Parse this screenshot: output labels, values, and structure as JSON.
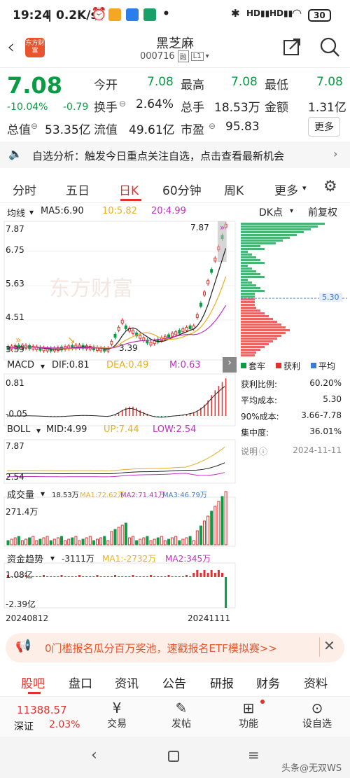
{
  "status": {
    "time": "19:24",
    "speed": "0.2K/s",
    "battery": "30"
  },
  "header": {
    "logo_text": "东方财富",
    "stock_name": "黑芝麻",
    "stock_code": "000716",
    "tag1": "融",
    "tag2": "L1"
  },
  "quote": {
    "price": "7.08",
    "change_pct": "-10.04%",
    "change": "-0.79",
    "open_label": "今开",
    "open": "7.08",
    "high_label": "最高",
    "high": "7.08",
    "low_label": "最低",
    "low": "7.08",
    "turnover_label": "换手",
    "turnover": "2.64%",
    "volume_label": "总手",
    "volume": "18.53万",
    "amount_label": "金额",
    "amount": "1.31亿",
    "mcap_label": "总值",
    "mcap": "53.35亿",
    "float_label": "流值",
    "float": "49.61亿",
    "pe_label": "市盈",
    "pe": "95.83",
    "more_label": "更多"
  },
  "banner": {
    "text": "自选分析：触发今日重点关注自选，点击查看最新机会"
  },
  "tabs": [
    "分时",
    "五日",
    "日K",
    "60分钟",
    "周K",
    "更多"
  ],
  "active_tab": "日K",
  "chart": {
    "ma_label": "均线",
    "ma5": "MA5:6.90",
    "ma10": "10:5.82",
    "ma20": "20:4.99",
    "dk_label": "DK点",
    "fq_label": "前复权",
    "y_ticks": [
      "7.87",
      "6.75",
      "5.63",
      "4.51",
      "3.39"
    ],
    "high_mark": "7.87",
    "low_mark": "3.39",
    "watermark": "东方财富",
    "cost_line": "5.30",
    "macd_label": "MACD",
    "dif": "DIF:0.81",
    "dea": "DEA:0.49",
    "m": "M:0.63",
    "macd_ticks": [
      "0.81",
      "-0.05"
    ],
    "boll_label": "BOLL",
    "mid": "MID:4.99",
    "up": "UP:7.44",
    "low": "LOW:2.54",
    "boll_ticks": [
      "7.87",
      "2.54"
    ],
    "vol_label": "成交量",
    "vol_value": "18.53万",
    "vma1": "MA1:72.62万",
    "vma2": "MA2:71.41万",
    "vma3": "MA3:46.79万",
    "vol_tick": "271.4万",
    "fund_label": "资金趋势",
    "fund_value": "-3111万",
    "fma1": "MA1:-2732万",
    "fma2": "MA2:345万",
    "fund_ticks": [
      "1.08亿",
      "-2.39亿"
    ],
    "date_start": "20240812",
    "date_end": "20241111"
  },
  "chip": {
    "legend": [
      "套牢",
      "获利",
      "平均"
    ],
    "rows": [
      {
        "label": "获利比例:",
        "value": "60.20%"
      },
      {
        "label": "平均成本:",
        "value": "5.30"
      },
      {
        "label": "90%成本:",
        "value": "3.66-7.78"
      },
      {
        "label": "集中度:",
        "value": "36.01%"
      }
    ],
    "note_label": "说明",
    "date": "2024-11-11"
  },
  "promo": {
    "text": "0门槛报名瓜分百万奖池，速戳报名ETF模拟赛>>"
  },
  "bottom_tabs": [
    "股吧",
    "盘口",
    "资讯",
    "公告",
    "研报",
    "财务",
    "资料"
  ],
  "index": {
    "value": "11388.57",
    "name": "深证",
    "pct": "2.03%"
  },
  "actions": [
    "交易",
    "发帖",
    "功能",
    "设自选"
  ],
  "watermark_text": "头条@无双WS",
  "colors": {
    "red": "#e0312f",
    "green": "#0a9b45",
    "blue": "#3d7ad6",
    "yellow": "#e8b020",
    "purple": "#c030c0"
  }
}
